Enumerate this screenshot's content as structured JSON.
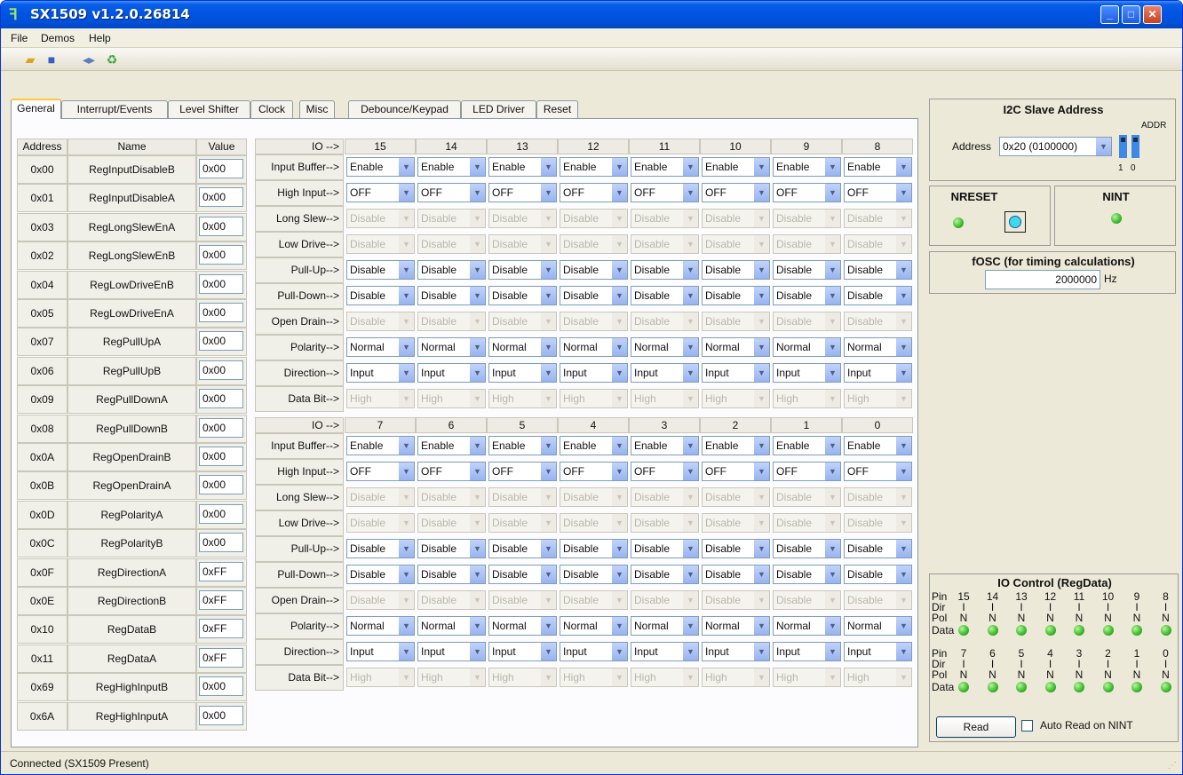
{
  "window": {
    "title": "SX1509 v1.2.0.26814",
    "minimize": "_",
    "maximize": "□",
    "close": "✕"
  },
  "menu": [
    "File",
    "Demos",
    "Help"
  ],
  "toolbar": {
    "icons": [
      "open-folder-icon",
      "save-icon",
      "connect-icon",
      "refresh-icon"
    ]
  },
  "tabs": [
    "General",
    "Interrupt/Events",
    "Level Shifter",
    "Clock",
    "Misc",
    "Debounce/Keypad",
    "LED Driver",
    "Reset"
  ],
  "registers": {
    "headers": [
      "Address",
      "Name",
      "Value"
    ],
    "rows": [
      [
        "0x00",
        "RegInputDisableB",
        "0x00"
      ],
      [
        "0x01",
        "RegInputDisableA",
        "0x00"
      ],
      [
        "0x03",
        "RegLongSlewEnA",
        "0x00"
      ],
      [
        "0x02",
        "RegLongSlewEnB",
        "0x00"
      ],
      [
        "0x04",
        "RegLowDriveEnB",
        "0x00"
      ],
      [
        "0x05",
        "RegLowDriveEnA",
        "0x00"
      ],
      [
        "0x07",
        "RegPullUpA",
        "0x00"
      ],
      [
        "0x06",
        "RegPullUpB",
        "0x00"
      ],
      [
        "0x09",
        "RegPullDownA",
        "0x00"
      ],
      [
        "0x08",
        "RegPullDownB",
        "0x00"
      ],
      [
        "0x0A",
        "RegOpenDrainB",
        "0x00"
      ],
      [
        "0x0B",
        "RegOpenDrainA",
        "0x00"
      ],
      [
        "0x0D",
        "RegPolarityA",
        "0x00"
      ],
      [
        "0x0C",
        "RegPolarityB",
        "0x00"
      ],
      [
        "0x0F",
        "RegDirectionA",
        "0xFF"
      ],
      [
        "0x0E",
        "RegDirectionB",
        "0xFF"
      ],
      [
        "0x10",
        "RegDataB",
        "0xFF"
      ],
      [
        "0x11",
        "RegDataA",
        "0xFF"
      ],
      [
        "0x69",
        "RegHighInputB",
        "0x00"
      ],
      [
        "0x6A",
        "RegHighInputA",
        "0x00"
      ]
    ]
  },
  "io": {
    "header_label": "IO -->",
    "pins_top": [
      "15",
      "14",
      "13",
      "12",
      "11",
      "10",
      "9",
      "8"
    ],
    "pins_bottom": [
      "7",
      "6",
      "5",
      "4",
      "3",
      "2",
      "1",
      "0"
    ],
    "rows": [
      {
        "label": "Input Buffer-->",
        "value": "Enable",
        "enabled": true
      },
      {
        "label": "High Input-->",
        "value": "OFF",
        "enabled": true
      },
      {
        "label": "Long Slew-->",
        "value": "Disable",
        "enabled": false
      },
      {
        "label": "Low Drive-->",
        "value": "Disable",
        "enabled": false
      },
      {
        "label": "Pull-Up-->",
        "value": "Disable",
        "enabled": true
      },
      {
        "label": "Pull-Down-->",
        "value": "Disable",
        "enabled": true
      },
      {
        "label": "Open Drain-->",
        "value": "Disable",
        "enabled": false
      },
      {
        "label": "Polarity-->",
        "value": "Normal",
        "enabled": true
      },
      {
        "label": "Direction-->",
        "value": "Input",
        "enabled": true
      },
      {
        "label": "Data Bit-->",
        "value": "High",
        "enabled": false
      }
    ]
  },
  "i2c": {
    "title": "I2C Slave Address",
    "addr_label": "ADDR",
    "address_label": "Address",
    "address_value": "0x20 (0100000)",
    "bits": [
      "1",
      "0"
    ]
  },
  "nreset": {
    "title": "NRESET"
  },
  "nint": {
    "title": "NINT"
  },
  "fosc": {
    "title": "fOSC (for timing calculations)",
    "value": "2000000",
    "unit": "Hz"
  },
  "io_control": {
    "title": "IO Control (RegData)",
    "row_labels": [
      "Pin",
      "Dir",
      "Pol",
      "Data"
    ],
    "pins_top": [
      "15",
      "14",
      "13",
      "12",
      "11",
      "10",
      "9",
      "8"
    ],
    "pins_bottom": [
      "7",
      "6",
      "5",
      "4",
      "3",
      "2",
      "1",
      "0"
    ],
    "dir": "I",
    "pol": "N",
    "read_label": "Read",
    "auto_read_label": "Auto Read on NINT"
  },
  "status": "Connected (SX1509 Present)",
  "colors": {
    "led_on": "#38B82A",
    "titlebar": "#0054E3",
    "reset_button": "#3FD8F2"
  }
}
